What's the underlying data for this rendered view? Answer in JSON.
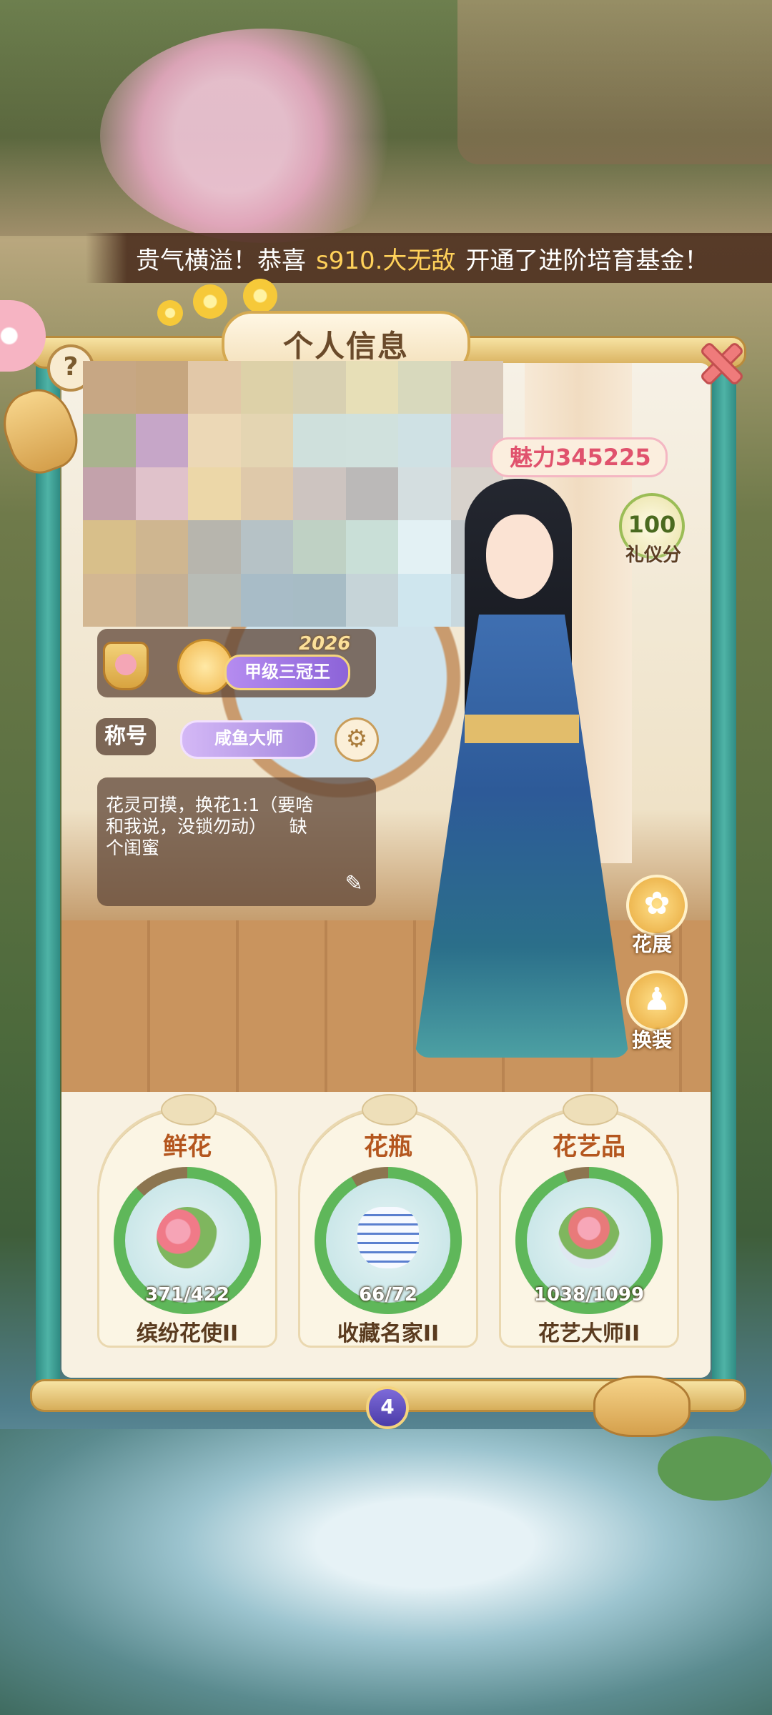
{
  "banner": {
    "prefix": "贵气横溢！恭喜",
    "player": "s910.大无敌",
    "suffix": "开通了进阶培育基金！"
  },
  "panel_title": "个人信息",
  "help_glyph": "?",
  "avatar_colors": [
    "#c7a784",
    "#c6a67f",
    "#e2c8a8",
    "#ddd1a8",
    "#d8d0b2",
    "#e7dfb7",
    "#d8d9bd",
    "#d8c8b8",
    "#a9b38e",
    "#c6a6c8",
    "#ecd8b6",
    "#e4d5b2",
    "#cfe0dc",
    "#d0e1dd",
    "#cfe1e4",
    "#dcc4ca",
    "#c3a2ab",
    "#e0c2cb",
    "#ecd7a8",
    "#dfc9aa",
    "#cdc4c0",
    "#bbb9b8",
    "#d4dee0",
    "#d8d2cc",
    "#d8bf8a",
    "#cfb690",
    "#b7b5ad",
    "#b6c2c6",
    "#bfd1c4",
    "#c9dfd7",
    "#e3f1f4",
    "#c3c8ca",
    "#d3b792",
    "#c5b095",
    "#b8bcb6",
    "#a8bcc7",
    "#a7bcc5",
    "#c6d4d8",
    "#cfe6ee",
    "#c8d8de"
  ],
  "charm": "魅力345225",
  "etiquette": {
    "value": "100",
    "label": "礼仪分"
  },
  "rank": {
    "year": "2026",
    "label": "甲级三冠王"
  },
  "title_label": "称号",
  "title_value": "咸鱼大师",
  "bio": "花灵可摸，换花1:1（要啥\n和我说，没锁勿动）    缺\n个闺蜜",
  "side_buttons": {
    "exhibit": "花展",
    "dressup": "换装"
  },
  "collections": [
    {
      "title": "鲜花",
      "current": 371,
      "total": 422,
      "count_text": "371/422",
      "rank": "缤纷花使II",
      "progress": 0.879
    },
    {
      "title": "花瓶",
      "current": 66,
      "total": 72,
      "count_text": "66/72",
      "rank": "收藏名家II",
      "progress": 0.917
    },
    {
      "title": "花艺品",
      "current": 1038,
      "total": 1099,
      "count_text": "1038/1099",
      "rank": "花艺大师II",
      "progress": 0.944
    }
  ],
  "page_number": "4",
  "colors": {
    "accent_gold": "#d5a951",
    "ring_green": "#5fb75a",
    "frame_teal": "#2f8b83"
  }
}
